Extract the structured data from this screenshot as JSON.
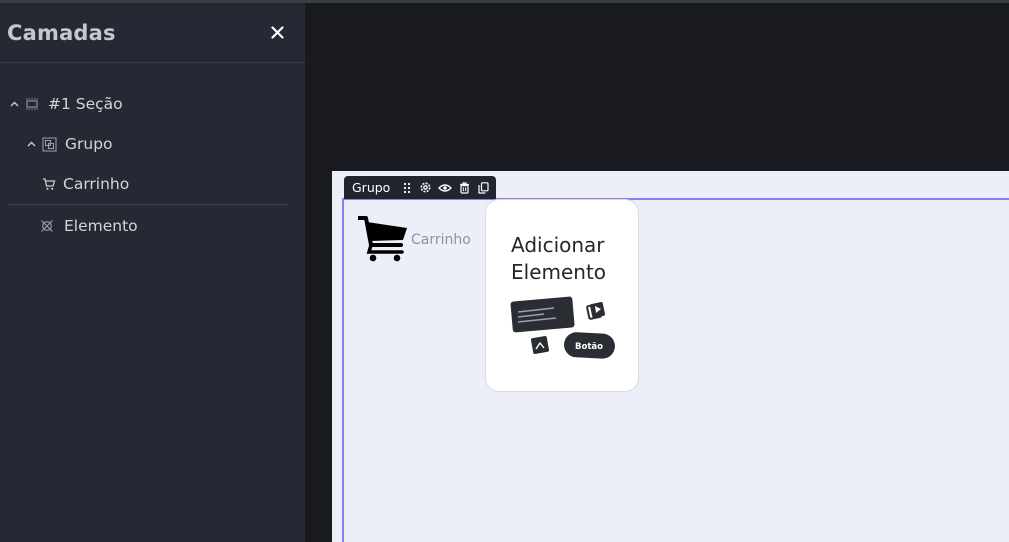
{
  "panel": {
    "title": "Camadas",
    "close_icon": "close-icon",
    "tree": {
      "section": {
        "label": "#1 Seção",
        "icon": "section-icon"
      },
      "group": {
        "label": "Grupo",
        "icon": "group-icon"
      },
      "cart": {
        "label": "Carrinho",
        "icon": "cart-icon"
      },
      "element": {
        "label": "Elemento",
        "icon": "element-icon"
      }
    }
  },
  "canvas": {
    "group_toolbar": {
      "label": "Grupo",
      "icons": [
        "drag-handle-icon",
        "settings-icon",
        "eye-icon",
        "trash-icon",
        "duplicate-icon"
      ]
    },
    "cart_widget": {
      "label": "Carrinho"
    },
    "add_element": {
      "title": "Adicionar Elemento",
      "button_sample": "Botão"
    }
  },
  "colors": {
    "panel_bg": "#262833",
    "canvas_bg": "#191a1f",
    "section_bg": "#eceff8",
    "selection_accent": "#8b7cf0",
    "toolbar_bg": "#23252e"
  }
}
